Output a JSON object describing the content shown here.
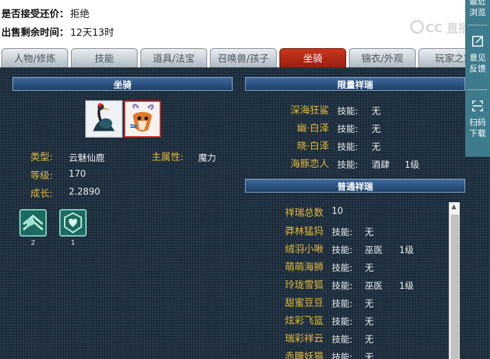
{
  "info": {
    "counter_offer_label": "是否接受还价：",
    "counter_offer_value": "拒绝",
    "time_left_label": "出售剩余时间：",
    "time_left_value": "12天13时"
  },
  "watermark": {
    "text": "CC 直播"
  },
  "tabs": [
    {
      "label": "人物/修炼",
      "active": false
    },
    {
      "label": "技能",
      "active": false
    },
    {
      "label": "道具/法宝",
      "active": false
    },
    {
      "label": "召唤兽/孩子",
      "active": false
    },
    {
      "label": "坐骑",
      "active": true
    },
    {
      "label": "锦衣/外观",
      "active": false
    },
    {
      "label": "玩家之家",
      "active": false
    }
  ],
  "mount": {
    "section_title": "坐骑",
    "icons": [
      "crane-mount-icon",
      "deer-mount-icon"
    ],
    "type_label": "类型:",
    "type_value": "云魅仙鹿",
    "attr_label": "主属性:",
    "attr_value": "魔力",
    "level_label": "等级:",
    "level_value": "170",
    "growth_label": "成长:",
    "growth_value": "2.2890",
    "equips": [
      {
        "icon": "gem-equip-icon",
        "count": "2"
      },
      {
        "icon": "heart-equip-icon",
        "count": "1"
      }
    ]
  },
  "limited": {
    "section_title": "限量祥瑞",
    "skill_label": "技能:",
    "items": [
      {
        "name": "深海狂鲨",
        "skill": "无",
        "level": ""
      },
      {
        "name": "幽·白泽",
        "skill": "无",
        "level": ""
      },
      {
        "name": "晓·白泽",
        "skill": "无",
        "level": ""
      },
      {
        "name": "海豚恋人",
        "skill": "酒肆",
        "level": "1级"
      }
    ]
  },
  "normal": {
    "section_title": "普通祥瑞",
    "total_label": "祥瑞总数",
    "total_value": "10",
    "skill_label": "技能:",
    "items": [
      {
        "name": "莽林猛犸",
        "skill": "无",
        "level": ""
      },
      {
        "name": "绒羽小啾",
        "skill": "巫医",
        "level": "1级"
      },
      {
        "name": "萌萌海狮",
        "skill": "无",
        "level": ""
      },
      {
        "name": "玲珑雪狐",
        "skill": "巫医",
        "level": "1级"
      },
      {
        "name": "甜蜜豆豆",
        "skill": "无",
        "level": ""
      },
      {
        "name": "炫彩飞篮",
        "skill": "无",
        "level": ""
      },
      {
        "name": "瑞彩祥云",
        "skill": "无",
        "level": ""
      },
      {
        "name": "赤瞳妖猫",
        "skill": "无",
        "level": ""
      }
    ]
  },
  "floatbar": {
    "recent_line1": "最近",
    "recent_line2": "浏览",
    "feedback_line1": "意见",
    "feedback_line2": "反馈",
    "download_line1": "扫码",
    "download_line2": "下载"
  },
  "colors": {
    "accent_tab": "#b52a14",
    "panel_bg": "#1d2c3a",
    "label_gold": "#e2b93c",
    "header_blue": "#2f5686"
  }
}
